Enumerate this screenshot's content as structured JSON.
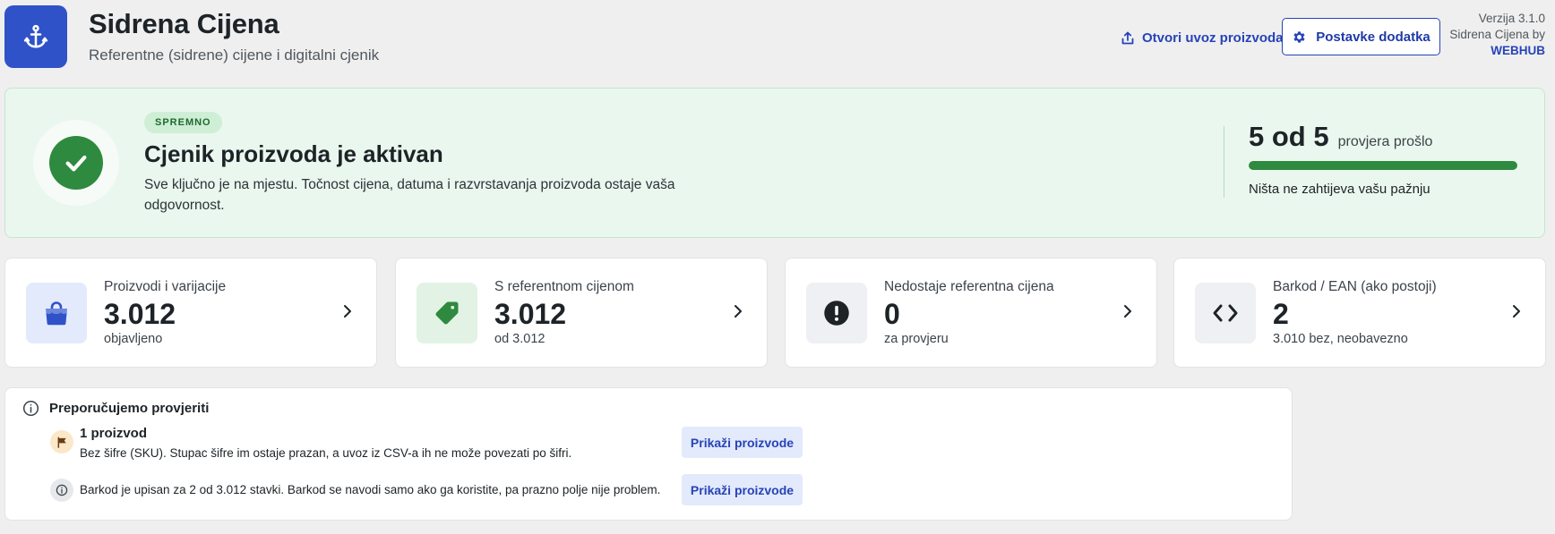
{
  "header": {
    "app_icon": "anchor-icon",
    "title": "Sidrena Cijena",
    "subtitle": "Referentne (sidrene) cijene i digitalni cjenik",
    "import_link": "Otvori uvoz proizvoda",
    "import_icon": "upload-icon",
    "settings_button": "Postavke dodatka",
    "settings_icon": "gear-icon",
    "version": "Verzija 3.1.0",
    "byline": "Sidrena Cijena by",
    "brand": "WEBHUB",
    "accent_color": "#2f52c9"
  },
  "status": {
    "badge": "SPREMNO",
    "title": "Cjenik proizvoda je aktivan",
    "description": "Sve ključno je na mjestu. Točnost cijena, datuma i razvrstavanja proizvoda ostaje vaša odgovornost.",
    "checks_count": "5 od 5",
    "checks_label": "provjera prošlo",
    "checks_passed": 5,
    "checks_total": 5,
    "note": "Ništa ne zahtijeva vašu pažnju",
    "success_color": "#2e8a3e"
  },
  "stats": [
    {
      "icon": "shop-icon",
      "label": "Proizvodi i varijacije",
      "value": "3.012",
      "sub": "objavljeno"
    },
    {
      "icon": "tag-icon",
      "label": "S referentnom cijenom",
      "value": "3.012",
      "sub": "od 3.012"
    },
    {
      "icon": "warning-icon",
      "label": "Nedostaje referentna cijena",
      "value": "0",
      "sub": "za provjeru"
    },
    {
      "icon": "code-icon",
      "label": "Barkod / EAN (ako postoji)",
      "value": "2",
      "sub": "3.010 bez, neobavezno"
    }
  ],
  "recommendations": {
    "title": "Preporučujemo provjeriti",
    "items": [
      {
        "icon": "flag-icon",
        "title": "1 proizvod",
        "text": "Bez šifre (SKU). Stupac šifre im ostaje prazan, a uvoz iz CSV-a ih ne može povezati po šifri.",
        "button": "Prikaži proizvode"
      },
      {
        "icon": "info-icon",
        "text": "Barkod je upisan za 2 od 3.012 stavki. Barkod se navodi samo ako ga koristite, pa prazno polje nije problem.",
        "button": "Prikaži proizvode"
      }
    ]
  }
}
